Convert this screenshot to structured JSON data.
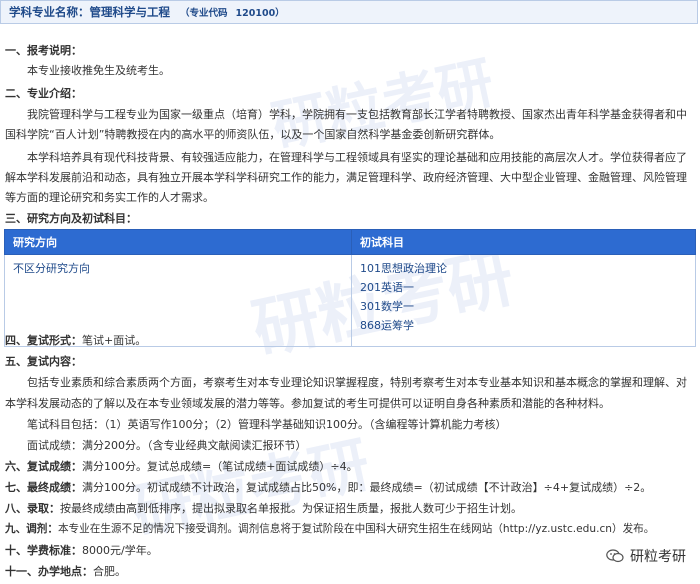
{
  "header": {
    "title": "学科专业名称：管理科学与工程",
    "code_label": "（专业代码",
    "code_value": "120100）"
  },
  "sections": {
    "s1_title": "一、报考说明：",
    "s1_text": "本专业接收推免生及统考生。",
    "s2_title": "二、专业介绍：",
    "s2_p1_line1": "我院管理科学与工程专业为国家一级重点（培育）学科，学院拥有一支包括教育部长江学者特聘教授、国家杰出青年科学基金获得者和中",
    "s2_p1_line2": "国科学院“百人计划”特聘教授在内的高水平的师资队伍，以及一个国家自然科学基金委创新研究群体。",
    "s2_p2_line1": "本学科培养具有现代科技背景、有较强适应能力，在管理科学与工程领域具有坚实的理论基础和应用技能的高层次人才。学位获得者应了",
    "s2_p2_line2": "解本学科发展前沿和动态，具有独立开展本学科学科研究工作的能力，满足管理科学、政府经济管理、大中型企业管理、金融管理、风险管理",
    "s2_p2_line3": "等方面的理论研究和务实工作的人才需求。",
    "s3_title": "三、研究方向及初试科目：",
    "table": {
      "col1": "研究方向",
      "col2": "初试科目",
      "direction": "不区分研究方向",
      "subjects": [
        "101思想政治理论",
        "201英语一",
        "301数学一",
        "868运筹学"
      ]
    },
    "s4_title": "四、复试形式：",
    "s4_value": "笔试+面试。",
    "s5_title": "五、复试内容：",
    "s5_line1": "包括专业素质和综合素质两个方面，考察考生对本专业理论知识掌握程度，特别考察考生对本专业基本知识和基本概念的掌握和理解、对",
    "s5_line2": "本学科发展动态的了解以及在本专业领域发展的潜力等等。参加复试的考生可提供可以证明自身各种素质和潜能的各种材料。",
    "s5_line3": "笔试科目包括：（1）英语写作100分；（2）管理科学基础知识100分。（含编程等计算机能力考核）",
    "s5_line4": "面试成绩：满分200分。（含专业经典文献阅读汇报环节）",
    "s6_title": "六、复试成绩：",
    "s6_value": "满分100分。复试总成绩=（笔试成绩+面试成绩）÷4。",
    "s7_title": "七、最终成绩：",
    "s7_value": "满分100分。初试成绩不计政治，复试成绩占比50%，即：最终成绩=（初试成绩【不计政治】÷4+复试成绩）÷2。",
    "s8_title": "八、录取：",
    "s8_value": "按最终成绩由高到低排序，提出拟录取名单报批。为保证招生质量，报批人数可少于招生计划。",
    "s9_title": "九、调剂：",
    "s9_value": "本专业在生源不足的情况下接受调剂。调剂信息将于复试阶段在中国科大研究生招生在线网站（http://yz.ustc.edu.cn）发布。",
    "s10_title": "十、学费标准：",
    "s10_value": "8000元/学年。",
    "s11_title": "十一、办学地点：",
    "s11_value": "合肥。"
  },
  "watermark": {
    "text1": "研粒考研",
    "text2": "研粒考研",
    "text3": "研粒考研"
  },
  "footer": {
    "logo_text": "研粒考研",
    "logo_icon": "wechat-icon"
  },
  "colors": {
    "header_text": "#1f4a8a",
    "table_header_bg": "#2d6bd1",
    "subject_text": "#1f4a8a"
  }
}
